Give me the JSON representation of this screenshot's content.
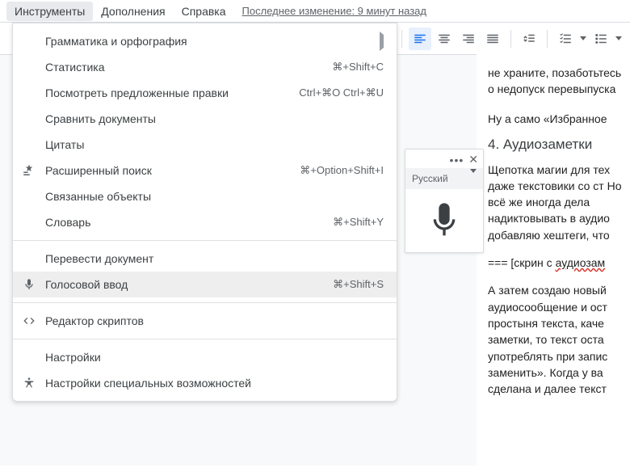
{
  "menubar": {
    "tools": "Инструменты",
    "addons": "Дополнения",
    "help": "Справка",
    "last_edit": "Последнее изменение: 9 минут назад"
  },
  "dropdown": {
    "items": [
      {
        "label": "Грамматика и орфография",
        "submenu": true
      },
      {
        "label": "Статистика",
        "shortcut": "⌘+Shift+C"
      },
      {
        "label": "Посмотреть предложенные правки",
        "shortcut": "Ctrl+⌘O Ctrl+⌘U"
      },
      {
        "label": "Сравнить документы"
      },
      {
        "label": "Цитаты"
      },
      {
        "label": "Расширенный поиск",
        "shortcut": "⌘+Option+Shift+I",
        "icon": "explore"
      },
      {
        "label": "Связанные объекты"
      },
      {
        "label": "Словарь",
        "shortcut": "⌘+Shift+Y"
      }
    ],
    "items2": [
      {
        "label": "Перевести документ"
      },
      {
        "label": "Голосовой ввод",
        "shortcut": "⌘+Shift+S",
        "icon": "mic",
        "highlight": true
      }
    ],
    "items3": [
      {
        "label": "Редактор скриптов",
        "icon": "script"
      }
    ],
    "items4": [
      {
        "label": "Настройки"
      },
      {
        "label": "Настройки специальных возможностей",
        "icon": "a11y"
      }
    ]
  },
  "voice": {
    "language": "Русский"
  },
  "doc": {
    "p1": "не храните, позаботьтесь о недопуск перевыпуска",
    "p2": "Ну а само «Избранное",
    "h": "4. Аудиозаметки",
    "p3": "Щепотка магии для тех даже текстовики со ст Но всё же иногда дела надиктовывать в аудио добавляю хештеги, что",
    "p4a": "=== [скрин с ",
    "p4b": "аудиозам",
    "p5": "А затем создаю новый аудиосообщение и ост простыня текста, каче заметки, то текст оста употреблять при запис заменить». Когда у ва сделана и далее текст"
  }
}
